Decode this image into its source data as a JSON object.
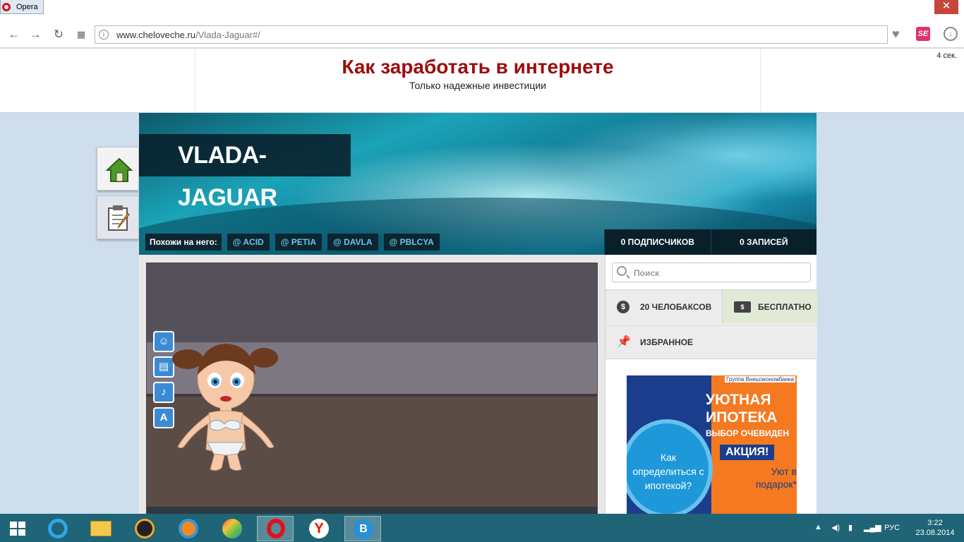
{
  "browser": {
    "tab_label": "Opera",
    "close_label": "✕",
    "url_host": "www.cheloveche.ru",
    "url_path": "/Vlada-Jaguar#/",
    "se_label": "SE"
  },
  "ad_banner": {
    "title": "Как заработать в интернете",
    "subtitle": "Только надежные инвестиции",
    "timer": "4 сек."
  },
  "profile": {
    "username": "VLADA-JAGUAR",
    "similar_label": "Похожи на него:",
    "similar_tags": [
      "@ ACID",
      "@ PETIA",
      "@ DAVLA",
      "@ PBLCYA"
    ],
    "followers": "0 ПОДПИСЧИКОВ",
    "posts": "0 ЗАПИСЕЙ"
  },
  "panel": {
    "search_placeholder": "Поиск",
    "price_label": "20 ЧЕЛОБАКСОВ",
    "free_label": "БЕСПЛАТНО",
    "favorites_label": "ИЗБРАННОЕ"
  },
  "side_ad": {
    "bank": "Группа Внешэкономбанка",
    "title": "УЮТНАЯ ИПОТЕКА",
    "tagline": "ВЫБОР ОЧЕВИДЕН",
    "promo": "АКЦИЯ!",
    "gift": "Уют в подарок*",
    "question": "Как определиться с ипотекой?"
  },
  "taskbar": {
    "language": "РУС",
    "time": "3:22",
    "date": "23.08.2014"
  }
}
